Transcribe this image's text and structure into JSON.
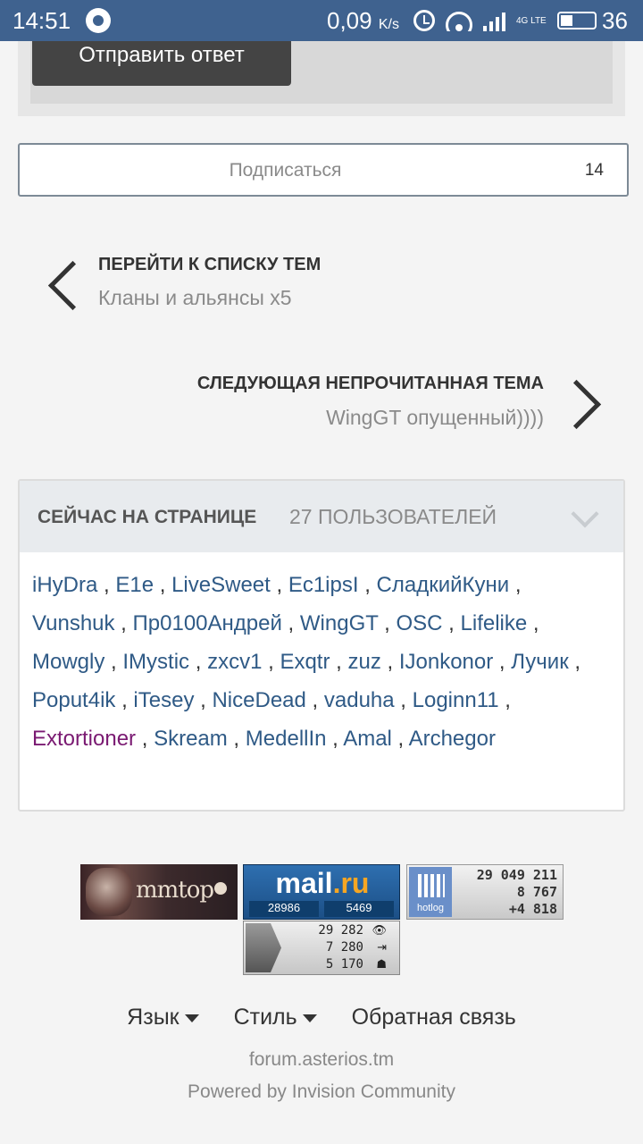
{
  "status_bar": {
    "time": "14:51",
    "speed": "0,09",
    "speed_unit": "K/s",
    "network": "4G LTE",
    "battery": "36"
  },
  "reply": {
    "submit_label": "Отправить ответ"
  },
  "subscribe": {
    "label": "Подписаться",
    "count": "14"
  },
  "nav": {
    "prev_title": "ПЕРЕЙТИ К СПИСКУ ТЕМ",
    "prev_sub": "Кланы и альянсы x5",
    "next_title": "СЛЕДУЮЩАЯ НЕПРОЧИТАННАЯ ТЕМА",
    "next_sub": "WingGT опущенный))))"
  },
  "online": {
    "title": "СЕЙЧАС НА СТРАНИЦЕ",
    "count": "27 ПОЛЬЗОВАТЕЛЕЙ",
    "users": [
      "iHyDra",
      "E1e",
      "LiveSweet",
      "Ec1ipsI",
      "СладкийКуни",
      "Vunshuk",
      "Пр0100Андрей",
      "WingGT",
      "OSC",
      "Lifelike",
      "Mowgly",
      "IMystic",
      "zxcv1",
      "Exqtr",
      "zuz",
      "IJonkonor",
      "Лучик",
      "Poput4ik",
      "iTesey",
      "NiceDead",
      "vaduha",
      "Loginn11",
      "Extortioner",
      "Skream",
      "MedellIn",
      "Amal",
      "Archegor"
    ]
  },
  "counters": {
    "mmotop": {
      "label": "mmtop"
    },
    "mailru": {
      "logo_a": "mail",
      "logo_b": ".ru",
      "v1": "28986",
      "v2": "5469"
    },
    "hotlog": {
      "label": "hotlog",
      "v1": "29 049 211",
      "v2": "8 767",
      "v3": "+4 818"
    },
    "liveinternet": {
      "v1": "29 282",
      "v2": "7 280",
      "v3": "5 170"
    }
  },
  "footer": {
    "language": "Язык",
    "style": "Стиль",
    "feedback": "Обратная связь",
    "domain": "forum.asterios.tm",
    "powered": "Powered by Invision Community"
  }
}
